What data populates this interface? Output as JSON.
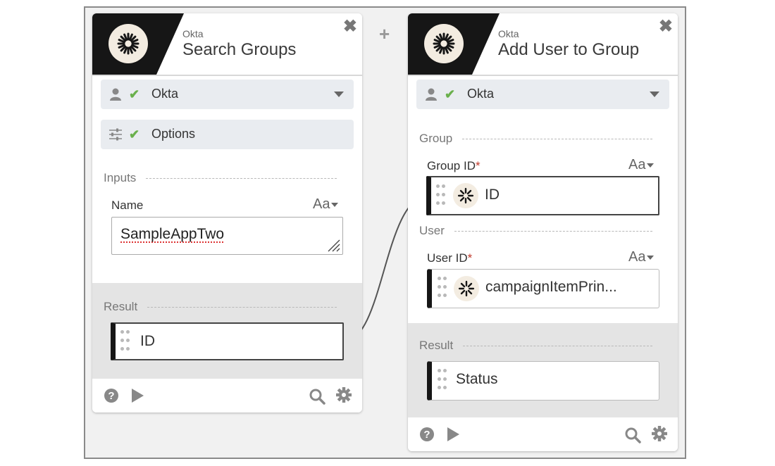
{
  "connector_plus": "+",
  "card1": {
    "vendor": "Okta",
    "title": "Search Groups",
    "close": "✖",
    "connection_label": "Okta",
    "options_label": "Options",
    "inputs_section": "Inputs",
    "name_label": "Name",
    "name_type": "Aa",
    "name_value": "SampleAppTwo",
    "result_section": "Result",
    "result_item": "ID"
  },
  "card2": {
    "vendor": "Okta",
    "title": "Add User to Group",
    "close": "✖",
    "connection_label": "Okta",
    "group_section": "Group",
    "group_id_label": "Group ID",
    "group_id_type": "Aa",
    "group_id_value": "ID",
    "user_section": "User",
    "user_id_label": "User ID",
    "user_id_type": "Aa",
    "user_id_value": "campaignItemPrin...",
    "result_section": "Result",
    "result_item": "Status",
    "required_mark": "*"
  },
  "colors": {
    "check": "#6ab04c",
    "required": "#c0392b",
    "brand_dark": "#161616"
  },
  "icons": [
    "okta-logo-icon",
    "user-icon",
    "sliders-icon",
    "check-icon",
    "help-icon",
    "play-icon",
    "search-icon",
    "gear-icon",
    "close-icon",
    "chevron-down-icon",
    "drag-grip-icon",
    "resize-handle-icon"
  ]
}
